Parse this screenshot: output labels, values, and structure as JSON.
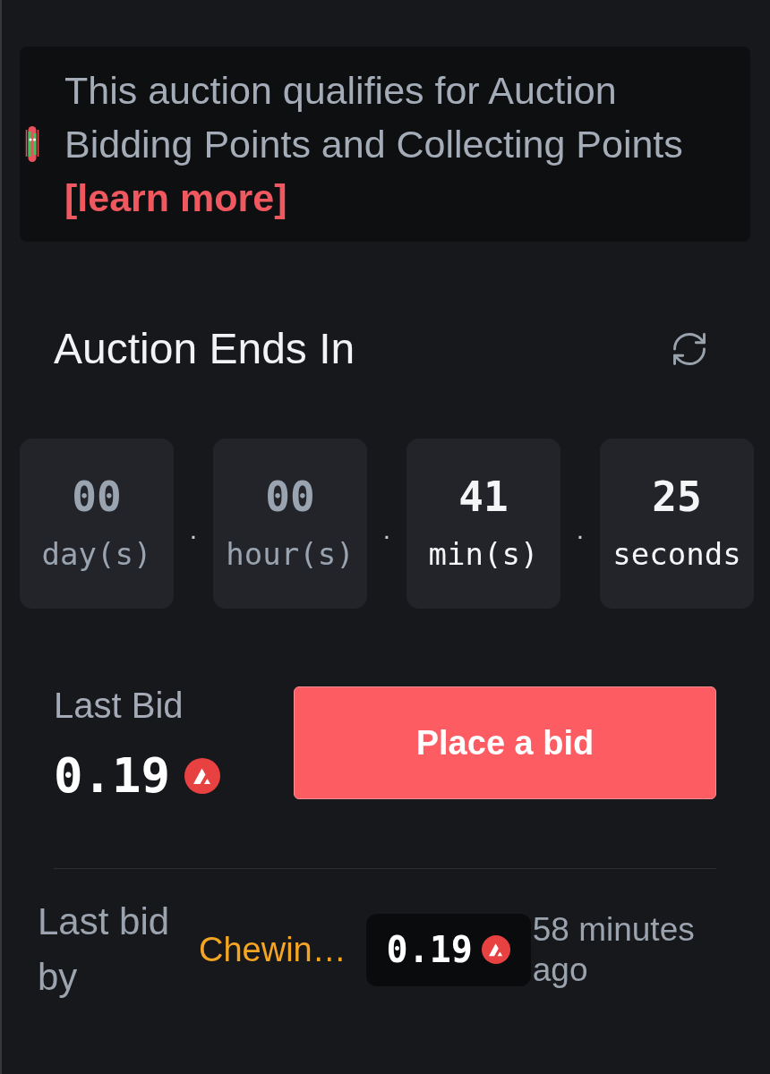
{
  "notice": {
    "text": "This auction qualifies for Auction Bidding Points and Collecting Points",
    "link": "[learn more]"
  },
  "countdown": {
    "title": "Auction Ends In",
    "units": [
      {
        "value": "00",
        "label": "day(s)",
        "dimmed": true
      },
      {
        "value": "00",
        "label": "hour(s)",
        "dimmed": true
      },
      {
        "value": "41",
        "label": "min(s)",
        "dimmed": false
      },
      {
        "value": "25",
        "label": "seconds",
        "dimmed": false
      }
    ],
    "separators": [
      ".",
      ".",
      "."
    ]
  },
  "last_bid": {
    "label": "Last Bid",
    "amount": "0.19"
  },
  "bid_button": {
    "label": "Place a bid"
  },
  "latest_bid": {
    "label": "Last bid by",
    "bidder": "Chewin…",
    "amount": "0.19",
    "time": "58 minutes ago"
  }
}
